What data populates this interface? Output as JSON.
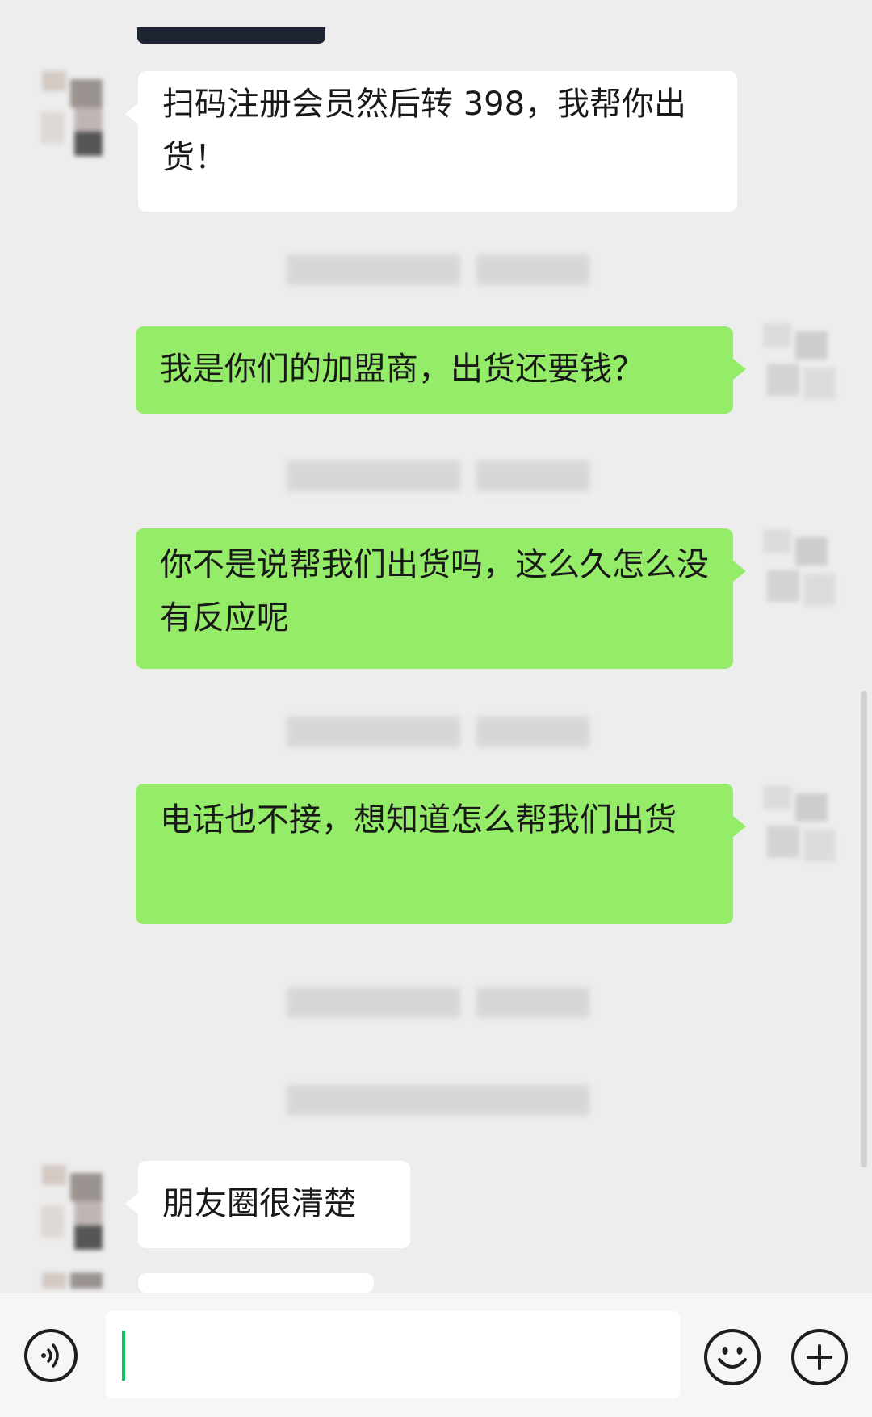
{
  "messages": [
    {
      "side": "in",
      "text": "扫码注册会员然后转 398，我帮你出货！"
    },
    {
      "side": "out",
      "text": "我是你们的加盟商，出货还要钱？"
    },
    {
      "side": "out",
      "text": "你不是说帮我们出货吗，这么久怎么没有反应呢"
    },
    {
      "side": "out",
      "text": "电话也不接，想知道怎么帮我们出货"
    },
    {
      "side": "in",
      "text": "朋友圈很清楚"
    }
  ],
  "input": {
    "value": ""
  },
  "icons": [
    "voice-icon",
    "emoji-icon",
    "plus-icon"
  ],
  "colors": {
    "background": "#ededed",
    "outgoing_bubble": "#95ec69",
    "incoming_bubble": "#ffffff",
    "caret": "#07c160"
  }
}
